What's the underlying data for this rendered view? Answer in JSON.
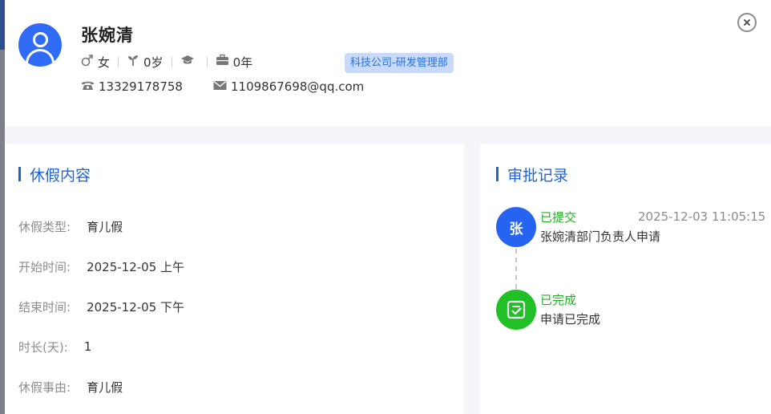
{
  "profile": {
    "name": "张婉清",
    "gender": "女",
    "age": "0岁",
    "tenure": "0年",
    "department": "科技公司-研发管理部",
    "phone": "13329178758",
    "email": "1109867698@qq.com"
  },
  "leave": {
    "title": "休假内容",
    "fields": [
      {
        "label": "休假类型:",
        "value": "育儿假"
      },
      {
        "label": "开始时间:",
        "value": "2025-12-05 上午"
      },
      {
        "label": "结束时间:",
        "value": "2025-12-05 下午"
      },
      {
        "label": "时长(天):",
        "value": "1"
      },
      {
        "label": "休假事由:",
        "value": "育儿假"
      }
    ]
  },
  "approval": {
    "title": "审批记录",
    "steps": [
      {
        "avatar_text": "张",
        "status": "已提交",
        "time": "2025-12-03 11:05:15",
        "desc": "张婉清部门负责人申请",
        "status_color": "#22b026"
      },
      {
        "avatar_icon": "check-square-icon",
        "status": "已完成",
        "desc": "申请已完成",
        "status_color": "#22b026"
      }
    ]
  },
  "colors": {
    "accent": "#1f63d9",
    "avatar_blue": "#2f6bf5",
    "success": "#22c027",
    "dept_tag_bg": "#c9daf8"
  }
}
